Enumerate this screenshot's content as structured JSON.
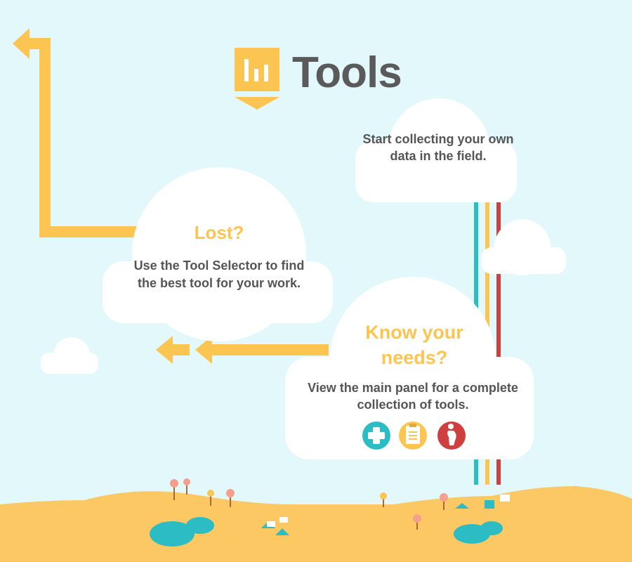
{
  "header": {
    "title": "Tools",
    "logo_icon": "bar-chart-icon"
  },
  "clouds": {
    "field": {
      "text": "Start collecting your own data in the field."
    },
    "lost": {
      "heading": "Lost?",
      "body": "Use the Tool Selector to find the best tool for your work."
    },
    "know": {
      "heading": "Know your needs?",
      "body": "View the main panel for a complete collection of tools."
    }
  },
  "tool_icons": [
    {
      "name": "health-cross-icon",
      "color": "#2bbcc4"
    },
    {
      "name": "clipboard-icon",
      "color": "#fcc552"
    },
    {
      "name": "pregnant-woman-icon",
      "color": "#cf3f3f"
    }
  ],
  "colors": {
    "sky": "#e2f8fb",
    "accent": "#fcc552",
    "ground": "#fcc863",
    "teal": "#2bbcc4",
    "red": "#cf3f3f",
    "text": "#555555"
  }
}
